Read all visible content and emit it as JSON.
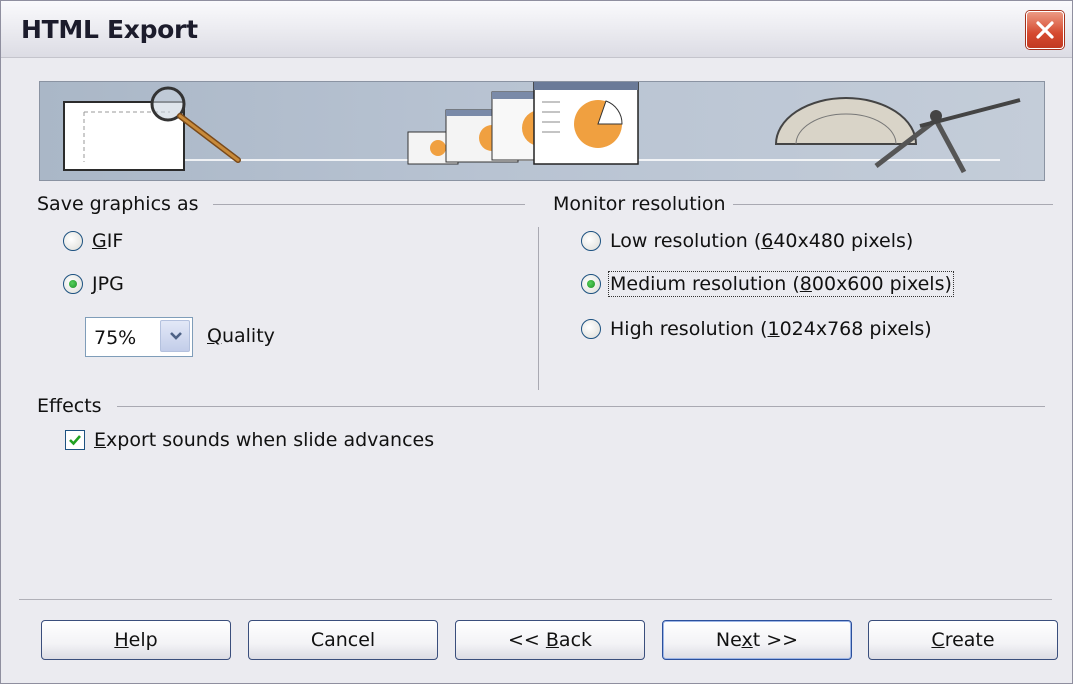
{
  "window": {
    "title": "HTML Export"
  },
  "icons": {
    "close": "close-x-icon"
  },
  "save_graphics": {
    "title": "Save graphics as",
    "gif": {
      "pre": "",
      "key": "G",
      "post": "IF",
      "checked": false
    },
    "jpg": {
      "pre": "",
      "key": "J",
      "post": "PG",
      "checked": true
    },
    "quality_value": "75%",
    "quality_label_key": "Q",
    "quality_label_rest": "uality"
  },
  "monitor_resolution": {
    "title": "Monitor resolution",
    "low": {
      "pre": "Low resolution (",
      "key": "6",
      "post": "40x480 pixels)",
      "checked": false
    },
    "medium": {
      "pre": "Medium resolution (",
      "key": "8",
      "post": "00x600 pixels)",
      "checked": true
    },
    "high": {
      "pre": "High resolution (",
      "key": "1",
      "post": "024x768 pixels)",
      "checked": false
    }
  },
  "effects": {
    "title": "Effects",
    "export_sounds": {
      "pre": "",
      "key": "E",
      "post": "xport sounds when slide advances",
      "checked": true
    }
  },
  "buttons": {
    "help": {
      "pre": "",
      "key": "H",
      "post": "elp"
    },
    "cancel": {
      "pre": "Cancel",
      "key": "",
      "post": ""
    },
    "back": {
      "pre": "<< ",
      "key": "B",
      "post": "ack"
    },
    "next": {
      "pre": "Ne",
      "key": "x",
      "post": "t >>"
    },
    "create": {
      "pre": "",
      "key": "C",
      "post": "reate"
    }
  },
  "colors": {
    "accent_orange": "#f0a040",
    "radio_dot": "#2a9a2f",
    "close_red": "#d5492f"
  }
}
